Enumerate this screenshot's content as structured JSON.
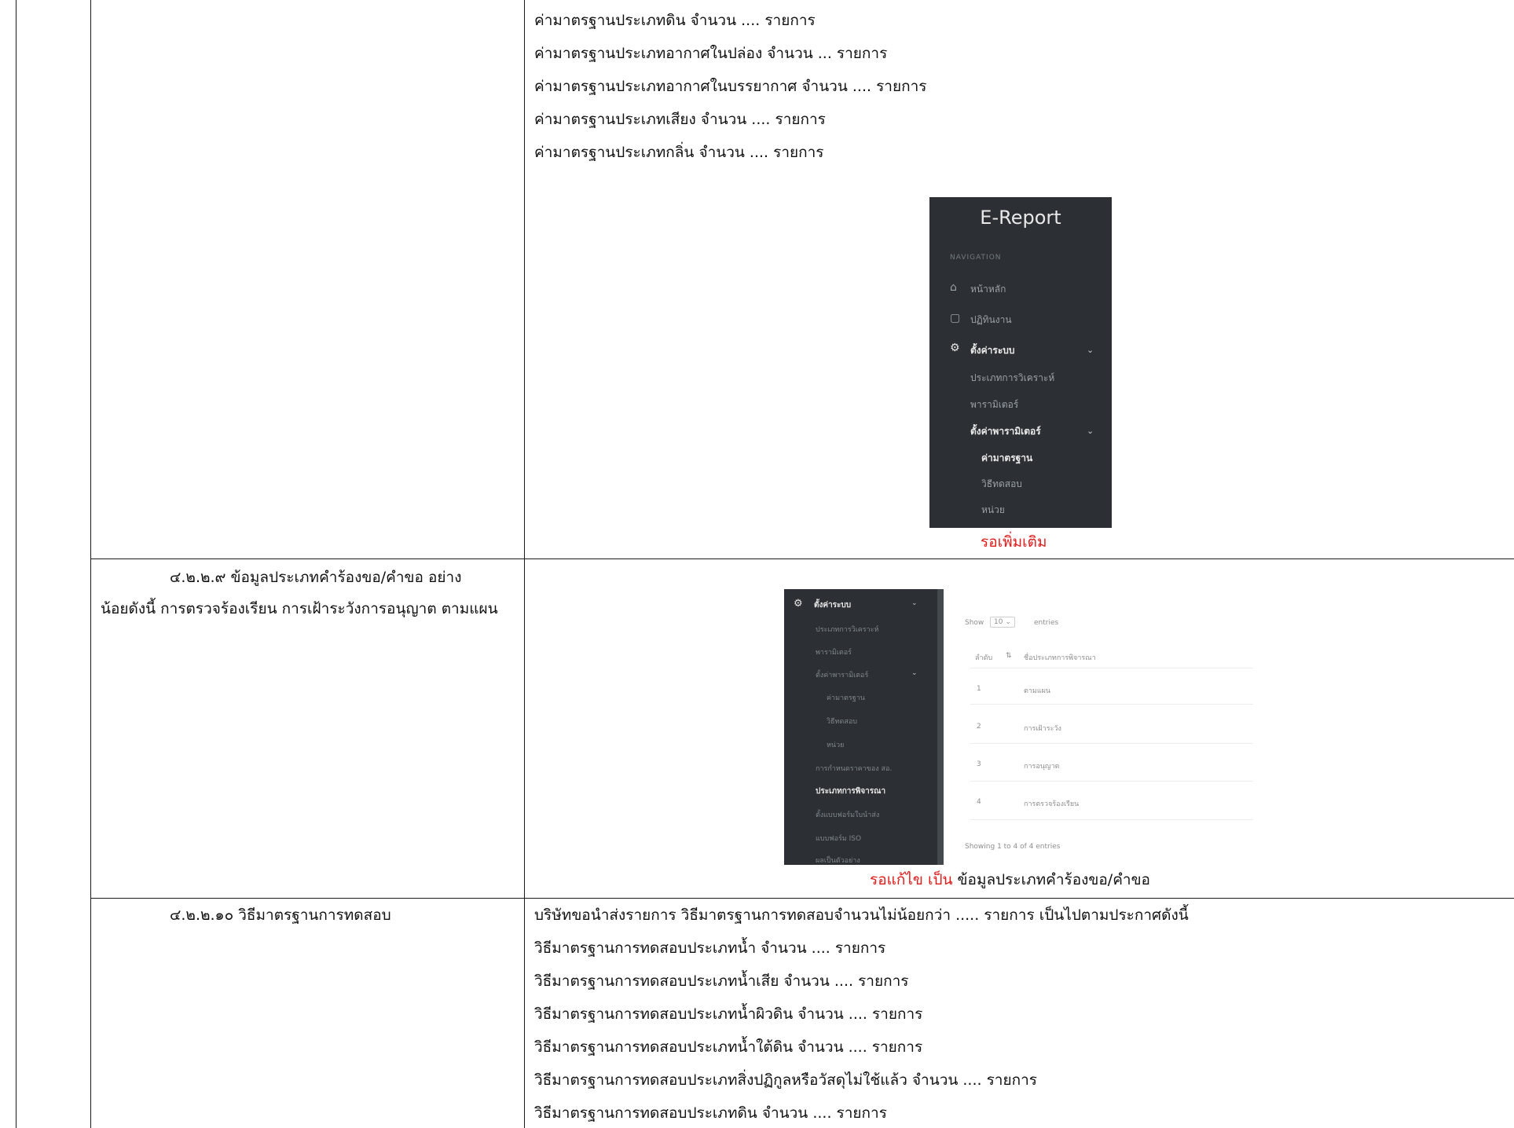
{
  "section_1": {
    "lines": [
      "ค่ามาตรฐานประเภทดิน จำนวน .... รายการ",
      "ค่ามาตรฐานประเภทอากาศในปล่อง จำนวน ... รายการ",
      "ค่ามาตรฐานประเภทอากาศในบรรยากาศ จำนวน .... รายการ",
      "ค่ามาตรฐานประเภทเสียง จำนวน .... รายการ",
      "ค่ามาตรฐานประเภทกลิ่น จำนวน .... รายการ"
    ],
    "screenshot": {
      "brand": "E-Report",
      "nav_header": "NAVIGATION",
      "items": [
        "หน้าหลัก",
        "ปฏิทินงาน",
        "ตั้งค่าระบบ",
        "ประเภทการวิเคราะห์",
        "พารามิเตอร์",
        "ตั้งค่าพารามิเตอร์",
        "ค่ามาตรฐาน",
        "วิธีทดสอบ",
        "หน่วย"
      ]
    },
    "note": "รอเพิ่มเติม"
  },
  "section_2": {
    "heading_line1": "๔.๒.๒.๙  ข้อมูลประเภทคำร้องขอ/คำขอ อย่าง",
    "heading_line2": "น้อยดังนี้ การตรวจร้องเรียน การเฝ้าระวังการอนุญาต ตามแผน",
    "screenshot": {
      "sidebar": [
        "ตั้งค่าระบบ",
        "ประเภทการวิเคราะห์",
        "พารามิเตอร์",
        "ตั้งค่าพารามิเตอร์",
        "ค่ามาตรฐาน",
        "วิธีทดสอบ",
        "หน่วย",
        "การกำหนดราคาของ สอ.",
        "ประเภทการพิจารณา",
        "ตั้งแบบฟอร์มใบนำส่ง",
        "แบบฟอร์ม ISO",
        "ผลเป็นตัวอย่าง"
      ],
      "show_label": "Show",
      "entries_value": "10",
      "entries_label": "entries",
      "col_no": "ลำดับ",
      "col_name": "ชื่อประเภทการพิจารณา",
      "rows": [
        {
          "no": "1",
          "name": "ตามแผน"
        },
        {
          "no": "2",
          "name": "การเฝ้าระวัง"
        },
        {
          "no": "3",
          "name": "การอนุญาต"
        },
        {
          "no": "4",
          "name": "การตรวจร้องเรียน"
        }
      ],
      "footer": "Showing 1 to 4 of 4 entries"
    },
    "note_red": "รอแก้ไข เป็น",
    "note_rest": "  ข้อมูลประเภทคำร้องขอ/คำขอ"
  },
  "section_3": {
    "heading": "๔.๒.๒.๑๐ วิธีมาตรฐานการทดสอบ",
    "lines": [
      "บริษัทขอนำส่งรายการ วิธีมาตรฐานการทดสอบจำนวนไม่น้อยกว่า ..... รายการ เป็นไปตามประกาศดังนี้",
      "วิธีมาตรฐานการทดสอบประเภทน้ำ จำนวน .... รายการ",
      "วิธีมาตรฐานการทดสอบประเภทน้ำเสีย จำนวน .... รายการ",
      "วิธีมาตรฐานการทดสอบประเภทน้ำผิวดิน จำนวน .... รายการ",
      "วิธีมาตรฐานการทดสอบประเภทน้ำใต้ดิน จำนวน .... รายการ",
      "วิธีมาตรฐานการทดสอบประเภทสิ่งปฏิกูลหรือวัสดุไม่ใช้แล้ว จำนวน .... รายการ",
      "วิธีมาตรฐานการทดสอบประเภทดิน จำนวน .... รายการ"
    ]
  }
}
